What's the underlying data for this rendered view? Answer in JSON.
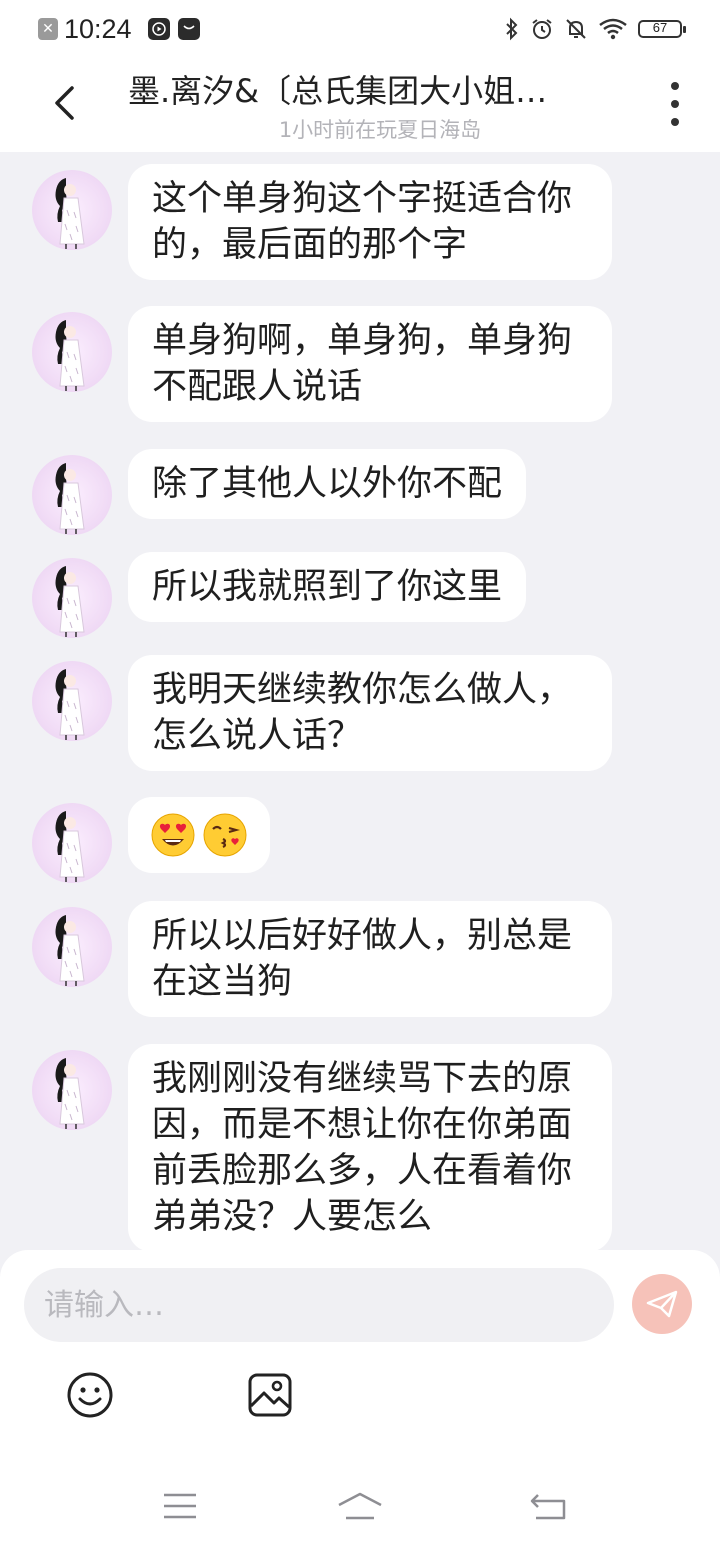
{
  "status_bar": {
    "time": "10:24",
    "battery": "67",
    "left_icons": [
      "close-notification-icon",
      "media-app-icon",
      "message-app-icon"
    ],
    "right_icons": [
      "bluetooth-icon",
      "alarm-icon",
      "mute-icon",
      "wifi-icon",
      "battery-icon"
    ]
  },
  "header": {
    "title": "墨.离汐&〔总氏集团大小姐…",
    "subtitle": "1小时前在玩夏日海岛"
  },
  "messages": [
    {
      "text": "这个单身狗这个字挺适合你的，最后面的那个字"
    },
    {
      "text": "单身狗啊，单身狗，单身狗不配跟人说话"
    },
    {
      "text": "除了其他人以外你不配"
    },
    {
      "text": "所以我就照到了你这里"
    },
    {
      "text": "我明天继续教你怎么做人，怎么说人话？"
    },
    {
      "emojis": [
        "heart-eyes-emoji",
        "kissing-face-emoji"
      ]
    },
    {
      "text": "所以以后好好做人，别总是在这当狗"
    },
    {
      "text": "我刚刚没有继续骂下去的原因，而是不想让你在你弟面前丢脸那么多，人在看着你弟弟没？人要怎么"
    }
  ],
  "input": {
    "placeholder": "请输入…"
  },
  "colors": {
    "background": "#f1f1f5",
    "bubble": "#ffffff",
    "send_button": "#f6c2b9",
    "subtitle": "#b3b3b8"
  }
}
